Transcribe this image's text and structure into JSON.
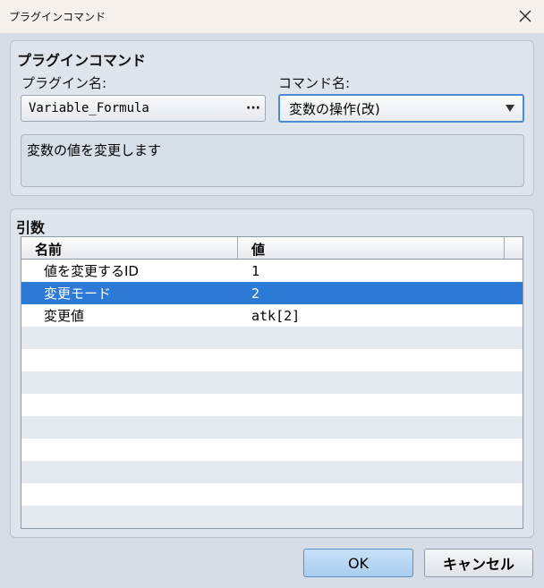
{
  "window": {
    "title": "プラグインコマンド"
  },
  "plugin_section": {
    "title": "プラグインコマンド",
    "plugin_name_label": "プラグイン名:",
    "plugin_name_value": "Variable_Formula",
    "plugin_name_button": "···",
    "command_name_label": "コマンド名:",
    "command_name_value": "変数の操作(改)",
    "description": "変数の値を変更します"
  },
  "args_section": {
    "title": "引数",
    "columns": [
      "名前",
      "値"
    ],
    "rows": [
      {
        "name": "値を変更するID",
        "value": "1"
      },
      {
        "name": "変更モード",
        "value": "2",
        "selected": true
      },
      {
        "name": "変更値",
        "value": "atk[2]"
      }
    ]
  },
  "buttons": {
    "ok": "OK",
    "cancel": "キャンセル"
  },
  "colors": {
    "selection": "#2c7ad6",
    "focus_border": "#4d8ad0"
  }
}
